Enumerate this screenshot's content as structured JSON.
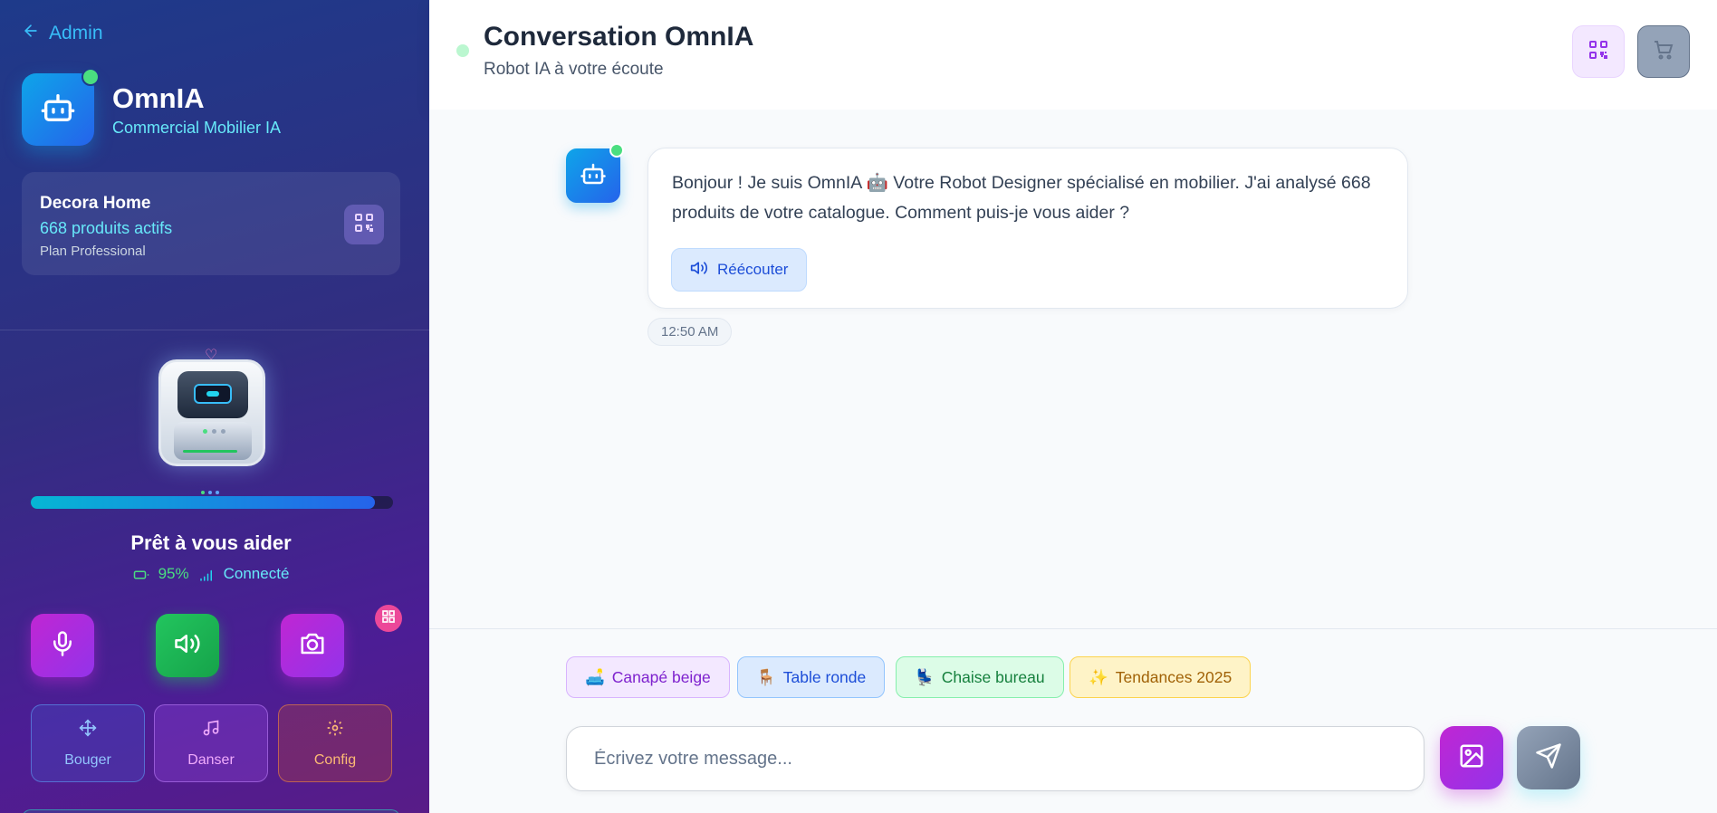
{
  "sidebar": {
    "back_label": "Admin",
    "brand": {
      "title": "OmnIA",
      "subtitle": "Commercial Mobilier IA"
    },
    "store": {
      "name": "Decora Home",
      "count": "668 produits actifs",
      "plan": "Plan Professional"
    },
    "robot": {
      "progress": 0.95,
      "status_title": "Prêt à vous aider",
      "battery": "95%",
      "connection": "Connecté"
    },
    "actions": [
      {
        "icon": "microphone-icon"
      },
      {
        "icon": "speaker-icon"
      },
      {
        "icon": "camera-icon"
      }
    ],
    "modes": [
      {
        "label": "Bouger",
        "icon": "move-icon"
      },
      {
        "label": "Danser",
        "icon": "music-icon"
      },
      {
        "label": "Config",
        "icon": "settings-icon"
      }
    ]
  },
  "header": {
    "title": "Conversation OmnIA",
    "subtitle": "Robot IA à votre écoute"
  },
  "chat": {
    "messages": [
      {
        "author": "bot",
        "text": "Bonjour ! Je suis OmnIA 🤖 Votre Robot Designer spécialisé en mobilier. J'ai analysé 668 produits de votre catalogue. Comment puis-je vous aider ?",
        "replay_label": "Réécouter",
        "time": "12:50 AM"
      }
    ]
  },
  "composer": {
    "suggestions": [
      {
        "emoji": "🛋️",
        "label": "Canapé beige"
      },
      {
        "emoji": "🪑",
        "label": "Table ronde"
      },
      {
        "emoji": "💺",
        "label": "Chaise bureau"
      },
      {
        "emoji": "✨",
        "label": "Tendances 2025"
      }
    ],
    "placeholder": "Écrivez votre message..."
  },
  "colors": {
    "sidebar_gradient": [
      "#1e3a8a",
      "#4c1d95"
    ],
    "accent_cyan": "#67e8f9",
    "accent_purple": "#9333ea",
    "accent_green": "#22c55e",
    "online": "#4ade80"
  }
}
